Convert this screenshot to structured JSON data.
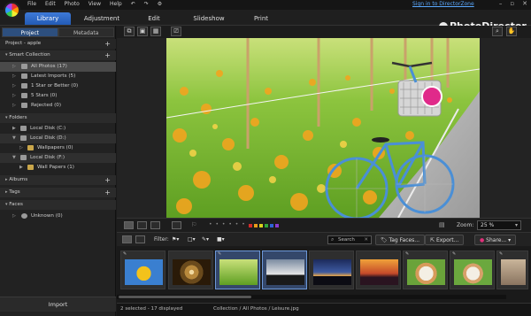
{
  "app": {
    "name": "PhotoDirector"
  },
  "menu": [
    "File",
    "Edit",
    "Photo",
    "View",
    "Help"
  ],
  "sign_in": "Sign in to DirectorZone",
  "tabs": [
    "Library",
    "Adjustment",
    "Edit",
    "Slideshow",
    "Print"
  ],
  "active_tab": "Library",
  "left_panel": {
    "subtabs": [
      "Project",
      "Metadata"
    ],
    "project_title": "Project - apple",
    "smart_collection": {
      "title": "Smart Collection",
      "items": [
        "All Photos (17)",
        "Latest Imports (5)",
        "1 Star or Better (0)",
        "5 Stars (0)",
        "Rejected (0)"
      ]
    },
    "folders": {
      "title": "Folders",
      "items": [
        "Local Disk (C:)",
        "Local Disk (D:)",
        "Wallpapers (0)",
        "Local Disk (F:)",
        "Wall Papers (1)"
      ]
    },
    "albums": "Albums",
    "tags": "Tags",
    "faces": {
      "title": "Faces",
      "items": [
        "Unknown (0)"
      ]
    },
    "import_label": "Import"
  },
  "controls": {
    "zoom_label": "Zoom:",
    "zoom_value": "25 %",
    "color_labels": [
      "#d42a2a",
      "#e89a1a",
      "#d9d21c",
      "#2fa53a",
      "#2f63d8",
      "#8a3ad0"
    ]
  },
  "filter_bar": {
    "filter_label": "Filter:",
    "search_placeholder": "Search",
    "tag_faces": "Tag Faces...",
    "export": "Export...",
    "share": "Share..."
  },
  "status": {
    "selection": "2 selected - 17 displayed",
    "path": "Collection / All Photos / Leisure.jpg"
  }
}
